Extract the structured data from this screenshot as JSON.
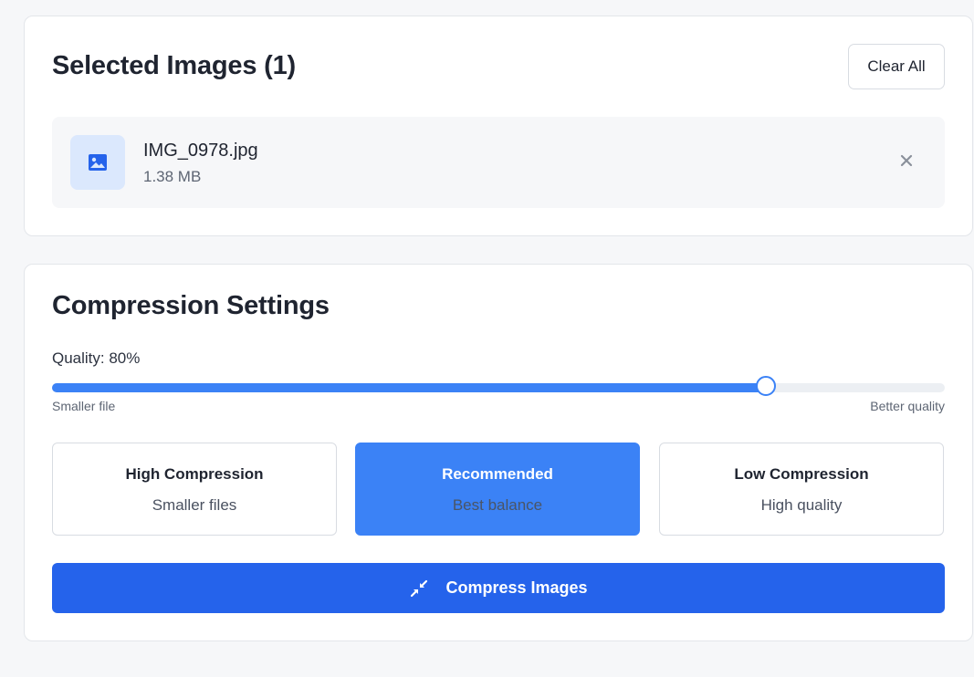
{
  "selected": {
    "title": "Selected Images (1)",
    "clear_label": "Clear All",
    "files": [
      {
        "name": "IMG_0978.jpg",
        "size": "1.38 MB",
        "icon": "image-icon",
        "remove_icon": "close-icon"
      }
    ]
  },
  "settings": {
    "title": "Compression Settings",
    "quality_label": "Quality: 80%",
    "quality_value": 80,
    "slider": {
      "min_label": "Smaller file",
      "max_label": "Better quality"
    },
    "presets": [
      {
        "title": "High Compression",
        "subtitle": "Smaller files",
        "active": false
      },
      {
        "title": "Recommended",
        "subtitle": "Best balance",
        "active": true
      },
      {
        "title": "Low Compression",
        "subtitle": "High quality",
        "active": false
      }
    ],
    "compress_label": "Compress Images",
    "compress_icon": "compress-icon"
  },
  "colors": {
    "accent": "#3b82f6",
    "primary_button": "#2563eb",
    "thumb_bg": "#dbe8fd"
  }
}
